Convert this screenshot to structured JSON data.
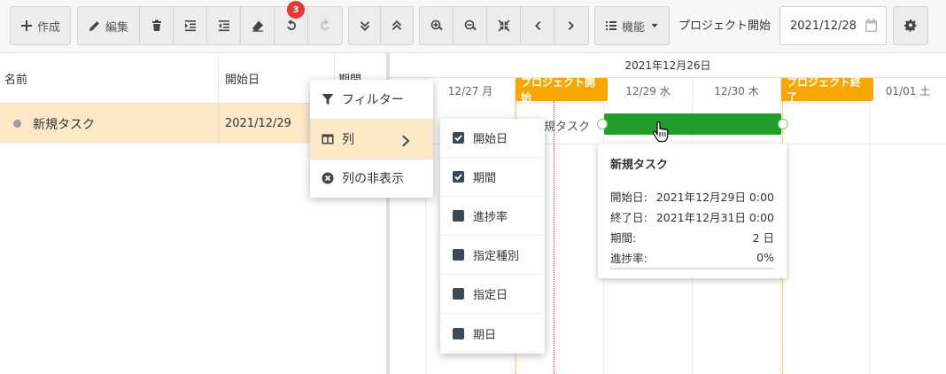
{
  "toolbar": {
    "create_label": "作成",
    "edit_label": "編集",
    "undo_badge": "3",
    "features_label": "機能",
    "project_start_label": "プロジェクト開始",
    "project_start_date": "2021/12/28"
  },
  "grid": {
    "columns": [
      "名前",
      "開始日",
      "期間"
    ],
    "row": {
      "name": "新規タスク",
      "start": "2021/12/29"
    }
  },
  "timeline": {
    "top_label": "2021年12月26日",
    "days": [
      "12/27 月",
      "12/29 水",
      "12/30 木",
      "01/01 土"
    ],
    "ms_start": "プロジェクト開始",
    "ms_end": "プロジェクト終了",
    "bar_label": "規タスク"
  },
  "tooltip": {
    "title": "新規タスク",
    "rows": [
      {
        "k": "開始日:",
        "v": "2021年12月29日 0:00"
      },
      {
        "k": "終了日:",
        "v": "2021年12月31日 0:00"
      },
      {
        "k": "期間:",
        "v": "2 日"
      },
      {
        "k": "進捗率:",
        "v": "0%"
      }
    ],
    "progress": 0
  },
  "menu": {
    "filter": "フィルター",
    "columns": "列",
    "hide_column": "列の非表示"
  },
  "column_menu": [
    {
      "label": "開始日",
      "checked": true
    },
    {
      "label": "期間",
      "checked": true
    },
    {
      "label": "進捗率",
      "checked": false
    },
    {
      "label": "指定種別",
      "checked": false
    },
    {
      "label": "指定日",
      "checked": false
    },
    {
      "label": "期日",
      "checked": false
    }
  ]
}
